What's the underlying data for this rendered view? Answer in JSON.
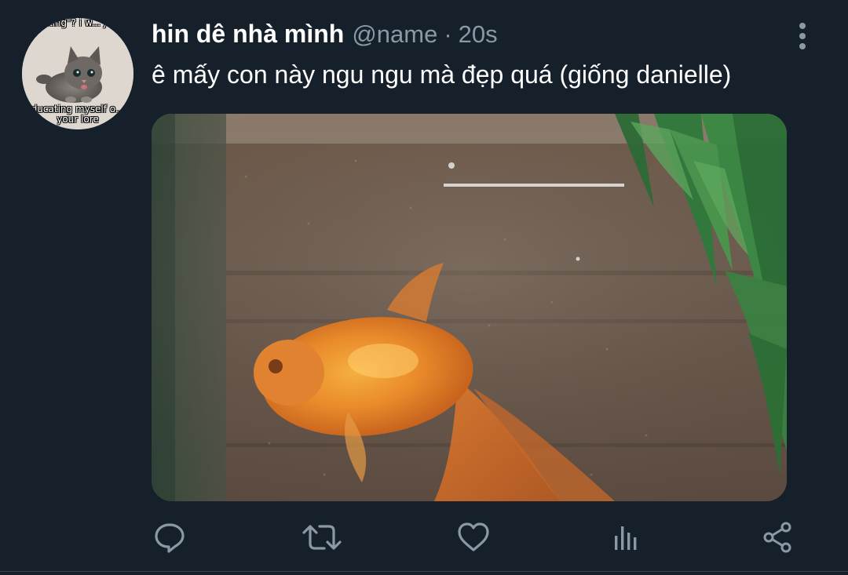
{
  "author": {
    "display_name": "hin dê nhà mình",
    "handle": "@name",
    "separator": "·",
    "timestamp": "20s",
    "avatar_caption_top": "talking\"? i w... just",
    "avatar_caption_bottom": "ducating myself o... your lore"
  },
  "tweet": {
    "text": "ê mấy con này ngu ngu mà đẹp quá (giống danielle)"
  },
  "media": {
    "subject": "goldfish-in-aquarium"
  },
  "actions": [
    {
      "name": "reply",
      "icon": "reply-icon"
    },
    {
      "name": "retweet",
      "icon": "retweet-icon"
    },
    {
      "name": "like",
      "icon": "heart-icon"
    },
    {
      "name": "analytics",
      "icon": "bar-chart-icon"
    },
    {
      "name": "share",
      "icon": "share-icon"
    }
  ],
  "colors": {
    "background": "#15202b",
    "primary_text": "#ffffff",
    "secondary_text": "#8b98a5",
    "icon": "#8b98a5",
    "divider": "#38444d"
  }
}
